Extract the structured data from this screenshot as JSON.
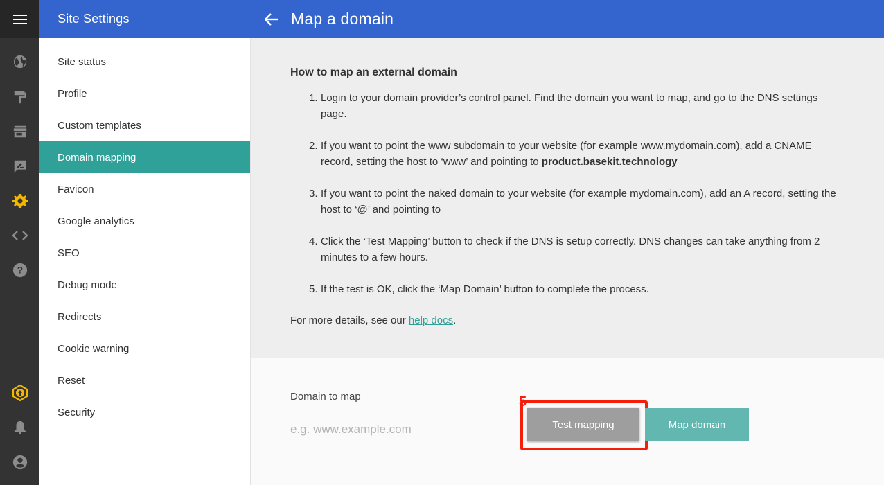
{
  "sidebar": {
    "title": "Site Settings",
    "items": [
      {
        "label": "Site status"
      },
      {
        "label": "Profile"
      },
      {
        "label": "Custom templates"
      },
      {
        "label": "Domain mapping",
        "active": true
      },
      {
        "label": "Favicon"
      },
      {
        "label": "Google analytics"
      },
      {
        "label": "SEO"
      },
      {
        "label": "Debug mode"
      },
      {
        "label": "Redirects"
      },
      {
        "label": "Cookie warning"
      },
      {
        "label": "Reset"
      },
      {
        "label": "Security"
      }
    ]
  },
  "rail": {
    "icons": [
      "menu-icon",
      "globe-icon",
      "paint-roller-icon",
      "store-icon",
      "edit-note-icon",
      "gear-icon",
      "code-icon",
      "help-icon",
      "upgrade-icon",
      "bell-icon",
      "account-icon"
    ],
    "active_icon": "gear-icon",
    "accent": "#f5b800"
  },
  "header": {
    "title": "Map a domain"
  },
  "info": {
    "heading": "How to map an external domain",
    "steps": [
      {
        "num": "1.",
        "text": "Login to your domain provider’s control panel. Find the domain you want to map, and go to the DNS settings page."
      },
      {
        "num": "2.",
        "text": "If you want to point the www subdomain to your website (for example www.mydomain.com), add a CNAME record, setting the host to ‘www’ and pointing to ",
        "bold": "product.basekit.technology"
      },
      {
        "num": "3.",
        "text": "If you want to point the naked domain to your website (for example mydomain.com), add an A record, setting the host to ‘@’ and pointing to"
      },
      {
        "num": "4.",
        "text": "Click the ‘Test Mapping’ button to check if the DNS is setup correctly. DNS changes can take anything from 2 minutes to a few hours."
      },
      {
        "num": "5.",
        "text": "If the test is OK, click the ‘Map Domain’ button to complete the process."
      }
    ],
    "more_prefix": "For more details, see our ",
    "more_link": "help docs",
    "more_suffix": "."
  },
  "form": {
    "label": "Domain to map",
    "placeholder": "e.g. www.example.com",
    "value": "",
    "test_button": "Test mapping",
    "map_button": "Map domain",
    "annotation": "5"
  },
  "colors": {
    "header_blue": "#3464cd",
    "teal": "#2fa198",
    "map_button": "#62b8b1",
    "test_button": "#9e9e9e",
    "annotation_red": "#f41e0b"
  }
}
